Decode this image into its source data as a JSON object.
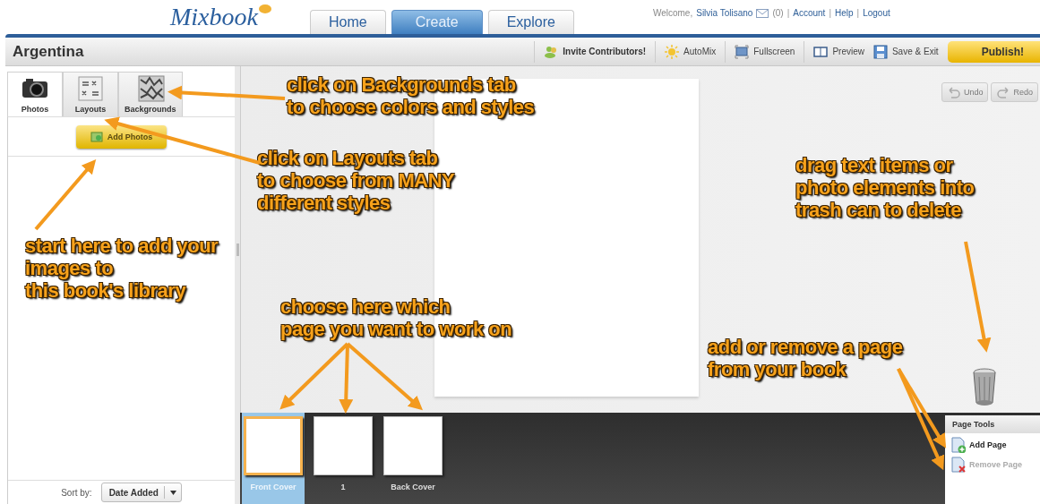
{
  "header": {
    "logo": "Mixbook",
    "nav": [
      {
        "label": "Home",
        "selected": false
      },
      {
        "label": "Create",
        "selected": true
      },
      {
        "label": "Explore",
        "selected": false
      }
    ],
    "welcome": {
      "prefix": "Welcome,",
      "user": "Silvia Tolisano",
      "messages": "(0)",
      "separator": "|",
      "links": [
        "Account",
        "Help",
        "Logout"
      ]
    }
  },
  "title_bar": {
    "title": "Argentina",
    "tools": [
      {
        "label": "Invite Contributors!",
        "kind": "invite"
      },
      {
        "label": "AutoMix",
        "kind": "automix"
      },
      {
        "label": "Fullscreen",
        "kind": "fullscreen"
      },
      {
        "label": "Preview",
        "kind": "preview"
      },
      {
        "label": "Save & Exit",
        "kind": "save"
      }
    ],
    "publish": "Publish!"
  },
  "left_panel": {
    "tabs": [
      {
        "label": "Photos",
        "kind": "camera",
        "selected": true
      },
      {
        "label": "Layouts",
        "kind": "layouts",
        "selected": false
      },
      {
        "label": "Backgrounds",
        "kind": "backgrounds",
        "selected": false
      }
    ],
    "add_button": "Add Photos",
    "sort": {
      "label": "Sort by:",
      "value": "Date Added"
    }
  },
  "canvas": {
    "history": [
      {
        "label": "Undo",
        "kind": "undo",
        "disabled": true
      },
      {
        "label": "Redo",
        "kind": "redo",
        "disabled": true
      }
    ]
  },
  "pages": [
    {
      "label": "Front Cover",
      "selected": true
    },
    {
      "label": "1",
      "selected": false
    },
    {
      "label": "Back Cover",
      "selected": false
    }
  ],
  "page_tools": {
    "title": "Page Tools",
    "items": [
      {
        "label": "Add Page",
        "kind": "add",
        "disabled": false
      },
      {
        "label": "Remove Page",
        "kind": "remove",
        "disabled": true
      }
    ]
  },
  "annotations": [
    {
      "kind": "backgrounds",
      "lines": [
        "click on Backgrounds tab",
        "to choose colors and styles"
      ]
    },
    {
      "kind": "layouts",
      "lines": [
        "click on Layouts tab",
        "to choose from MANY",
        "different styles"
      ]
    },
    {
      "kind": "photos",
      "lines": [
        "start here to add your",
        "images to",
        "this book's library"
      ]
    },
    {
      "kind": "pages",
      "lines": [
        "choose here which",
        "page you want to work on"
      ]
    },
    {
      "kind": "trash",
      "lines": [
        "drag text items or",
        "photo elements into",
        "trash can to delete"
      ]
    },
    {
      "kind": "pagetools",
      "lines": [
        "add or remove a page",
        "from your book"
      ]
    }
  ]
}
